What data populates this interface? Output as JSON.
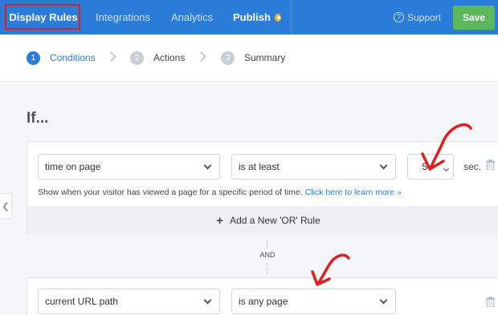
{
  "nav": {
    "tabs": [
      {
        "label": "Display Rules",
        "active": true
      },
      {
        "label": "Integrations",
        "active": false
      },
      {
        "label": "Analytics",
        "active": false
      },
      {
        "label": "Publish",
        "active": false
      }
    ],
    "support_label": "Support",
    "save_label": "Save"
  },
  "steps": [
    {
      "number": "1",
      "label": "Conditions",
      "active": true
    },
    {
      "number": "2",
      "label": "Actions",
      "active": false
    },
    {
      "number": "3",
      "label": "Summary",
      "active": false
    }
  ],
  "main": {
    "heading": "If...",
    "rule1": {
      "condition": "time on page",
      "operator": "is at least",
      "value": "5",
      "unit": "sec.",
      "help_text": "Show when your visitor has viewed a page for a specific period of time.",
      "help_link": "Click here to learn more »",
      "or_button": "Add a New 'OR' Rule"
    },
    "and_label": "AND",
    "rule2": {
      "condition": "current URL path",
      "operator": "is any page"
    }
  },
  "colors": {
    "nav_bg": "#2b7bd8",
    "save_bg": "#5cb85c",
    "highlight_box": "#e02020",
    "annotation_arrow": "#e02020"
  }
}
